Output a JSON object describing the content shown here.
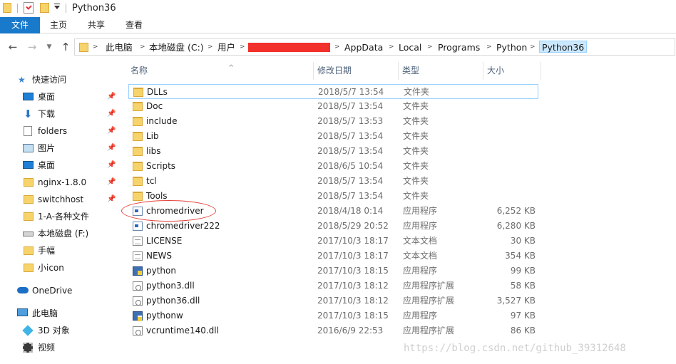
{
  "window": {
    "title": "Python36"
  },
  "ribbon": {
    "tabs": [
      "文件",
      "主页",
      "共享",
      "查看"
    ]
  },
  "address": {
    "crumbs": [
      "此电脑",
      "本地磁盘 (C:)",
      "用户",
      "AppData",
      "Local",
      "Programs",
      "Python",
      "Python36"
    ]
  },
  "navpane": {
    "quick_access": "快速访问",
    "items": [
      {
        "label": "桌面",
        "icon": "desktop-icon",
        "pinned": true
      },
      {
        "label": "下载",
        "icon": "download-icon",
        "pinned": true
      },
      {
        "label": "folders",
        "icon": "document-icon",
        "pinned": true
      },
      {
        "label": "图片",
        "icon": "pictures-icon",
        "pinned": true
      },
      {
        "label": "桌面",
        "icon": "desktop-icon",
        "pinned": true
      },
      {
        "label": "nginx-1.8.0",
        "icon": "folder-icon",
        "pinned": true
      },
      {
        "label": "switchhost",
        "icon": "folder-icon",
        "pinned": true
      },
      {
        "label": "1-A-各种文件",
        "icon": "folder-icon",
        "pinned": false
      },
      {
        "label": "本地磁盘 (F:)",
        "icon": "drive-icon",
        "pinned": false
      },
      {
        "label": "手幅",
        "icon": "folder-icon",
        "pinned": false
      },
      {
        "label": "小icon",
        "icon": "folder-icon",
        "pinned": false
      }
    ],
    "onedrive": "OneDrive",
    "this_pc": "此电脑",
    "pc_items": [
      {
        "label": "3D 对象",
        "icon": "3d-objects-icon"
      },
      {
        "label": "视频",
        "icon": "video-icon"
      }
    ]
  },
  "columns": {
    "name": "名称",
    "date": "修改日期",
    "type": "类型",
    "size": "大小"
  },
  "files": [
    {
      "name": "DLLs",
      "date": "2018/5/7 13:54",
      "type": "文件夹",
      "size": "",
      "icon": "folder-icon"
    },
    {
      "name": "Doc",
      "date": "2018/5/7 13:54",
      "type": "文件夹",
      "size": "",
      "icon": "folder-icon"
    },
    {
      "name": "include",
      "date": "2018/5/7 13:53",
      "type": "文件夹",
      "size": "",
      "icon": "folder-icon"
    },
    {
      "name": "Lib",
      "date": "2018/5/7 13:54",
      "type": "文件夹",
      "size": "",
      "icon": "folder-icon"
    },
    {
      "name": "libs",
      "date": "2018/5/7 13:54",
      "type": "文件夹",
      "size": "",
      "icon": "folder-icon"
    },
    {
      "name": "Scripts",
      "date": "2018/6/5 10:54",
      "type": "文件夹",
      "size": "",
      "icon": "folder-icon"
    },
    {
      "name": "tcl",
      "date": "2018/5/7 13:54",
      "type": "文件夹",
      "size": "",
      "icon": "folder-icon"
    },
    {
      "name": "Tools",
      "date": "2018/5/7 13:54",
      "type": "文件夹",
      "size": "",
      "icon": "folder-icon"
    },
    {
      "name": "chromedriver",
      "date": "2018/4/18 0:14",
      "type": "应用程序",
      "size": "6,252 KB",
      "icon": "exe-icon"
    },
    {
      "name": "chromedriver222",
      "date": "2018/5/29 20:52",
      "type": "应用程序",
      "size": "6,280 KB",
      "icon": "exe-icon"
    },
    {
      "name": "LICENSE",
      "date": "2017/10/3 18:17",
      "type": "文本文档",
      "size": "30 KB",
      "icon": "text-file-icon"
    },
    {
      "name": "NEWS",
      "date": "2017/10/3 18:17",
      "type": "文本文档",
      "size": "354 KB",
      "icon": "text-file-icon"
    },
    {
      "name": "python",
      "date": "2017/10/3 18:15",
      "type": "应用程序",
      "size": "99 KB",
      "icon": "python-icon"
    },
    {
      "name": "python3.dll",
      "date": "2017/10/3 18:12",
      "type": "应用程序扩展",
      "size": "58 KB",
      "icon": "dll-icon"
    },
    {
      "name": "python36.dll",
      "date": "2017/10/3 18:12",
      "type": "应用程序扩展",
      "size": "3,527 KB",
      "icon": "dll-icon"
    },
    {
      "name": "pythonw",
      "date": "2017/10/3 18:15",
      "type": "应用程序",
      "size": "97 KB",
      "icon": "pythonw-icon"
    },
    {
      "name": "vcruntime140.dll",
      "date": "2016/6/9 22:53",
      "type": "应用程序扩展",
      "size": "86 KB",
      "icon": "dll-icon"
    }
  ],
  "watermark": "https://blog.csdn.net/github_39312648"
}
